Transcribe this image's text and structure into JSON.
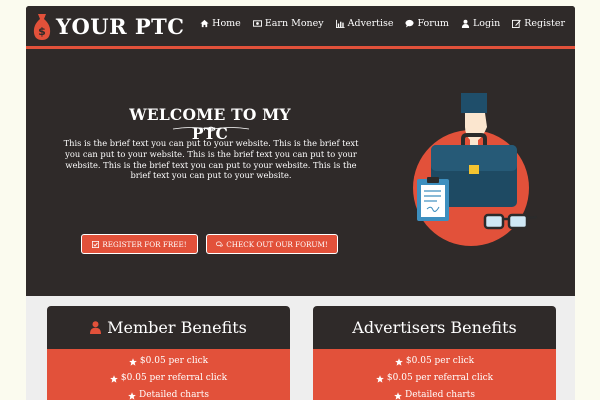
{
  "header": {
    "logo_text": "YOUR PTC",
    "nav": [
      {
        "label": "Home",
        "icon": "home-icon"
      },
      {
        "label": "Earn Money",
        "icon": "money-icon"
      },
      {
        "label": "Advertise",
        "icon": "bar-chart-icon"
      },
      {
        "label": "Forum",
        "icon": "comment-icon"
      },
      {
        "label": "Login",
        "icon": "user-icon"
      },
      {
        "label": "Register",
        "icon": "edit-icon"
      }
    ]
  },
  "hero": {
    "title": "WELCOME TO MY PTC",
    "text": "This is the brief text you can put to your website. This is the brief text you can put to your website. This is the brief text you can put to your website. This is the brief text you can put to your website. This is the brief text you can put to your website.",
    "register_label": "REGISTER FOR FREE!",
    "forum_label": "CHECK OUT OUR FORUM!"
  },
  "member_benefits": {
    "title": "Member Benefits",
    "items": [
      "$0.05 per click",
      "$0.05 per referral click",
      "Detailed charts"
    ]
  },
  "advertiser_benefits": {
    "title": "Advertisers Benefits",
    "items": [
      "$0.05 per click",
      "$0.05 per referral click",
      "Detailed charts"
    ]
  },
  "colors": {
    "background": "#2f2a29",
    "accent": "#e2513a",
    "page": "#fbfbef"
  }
}
